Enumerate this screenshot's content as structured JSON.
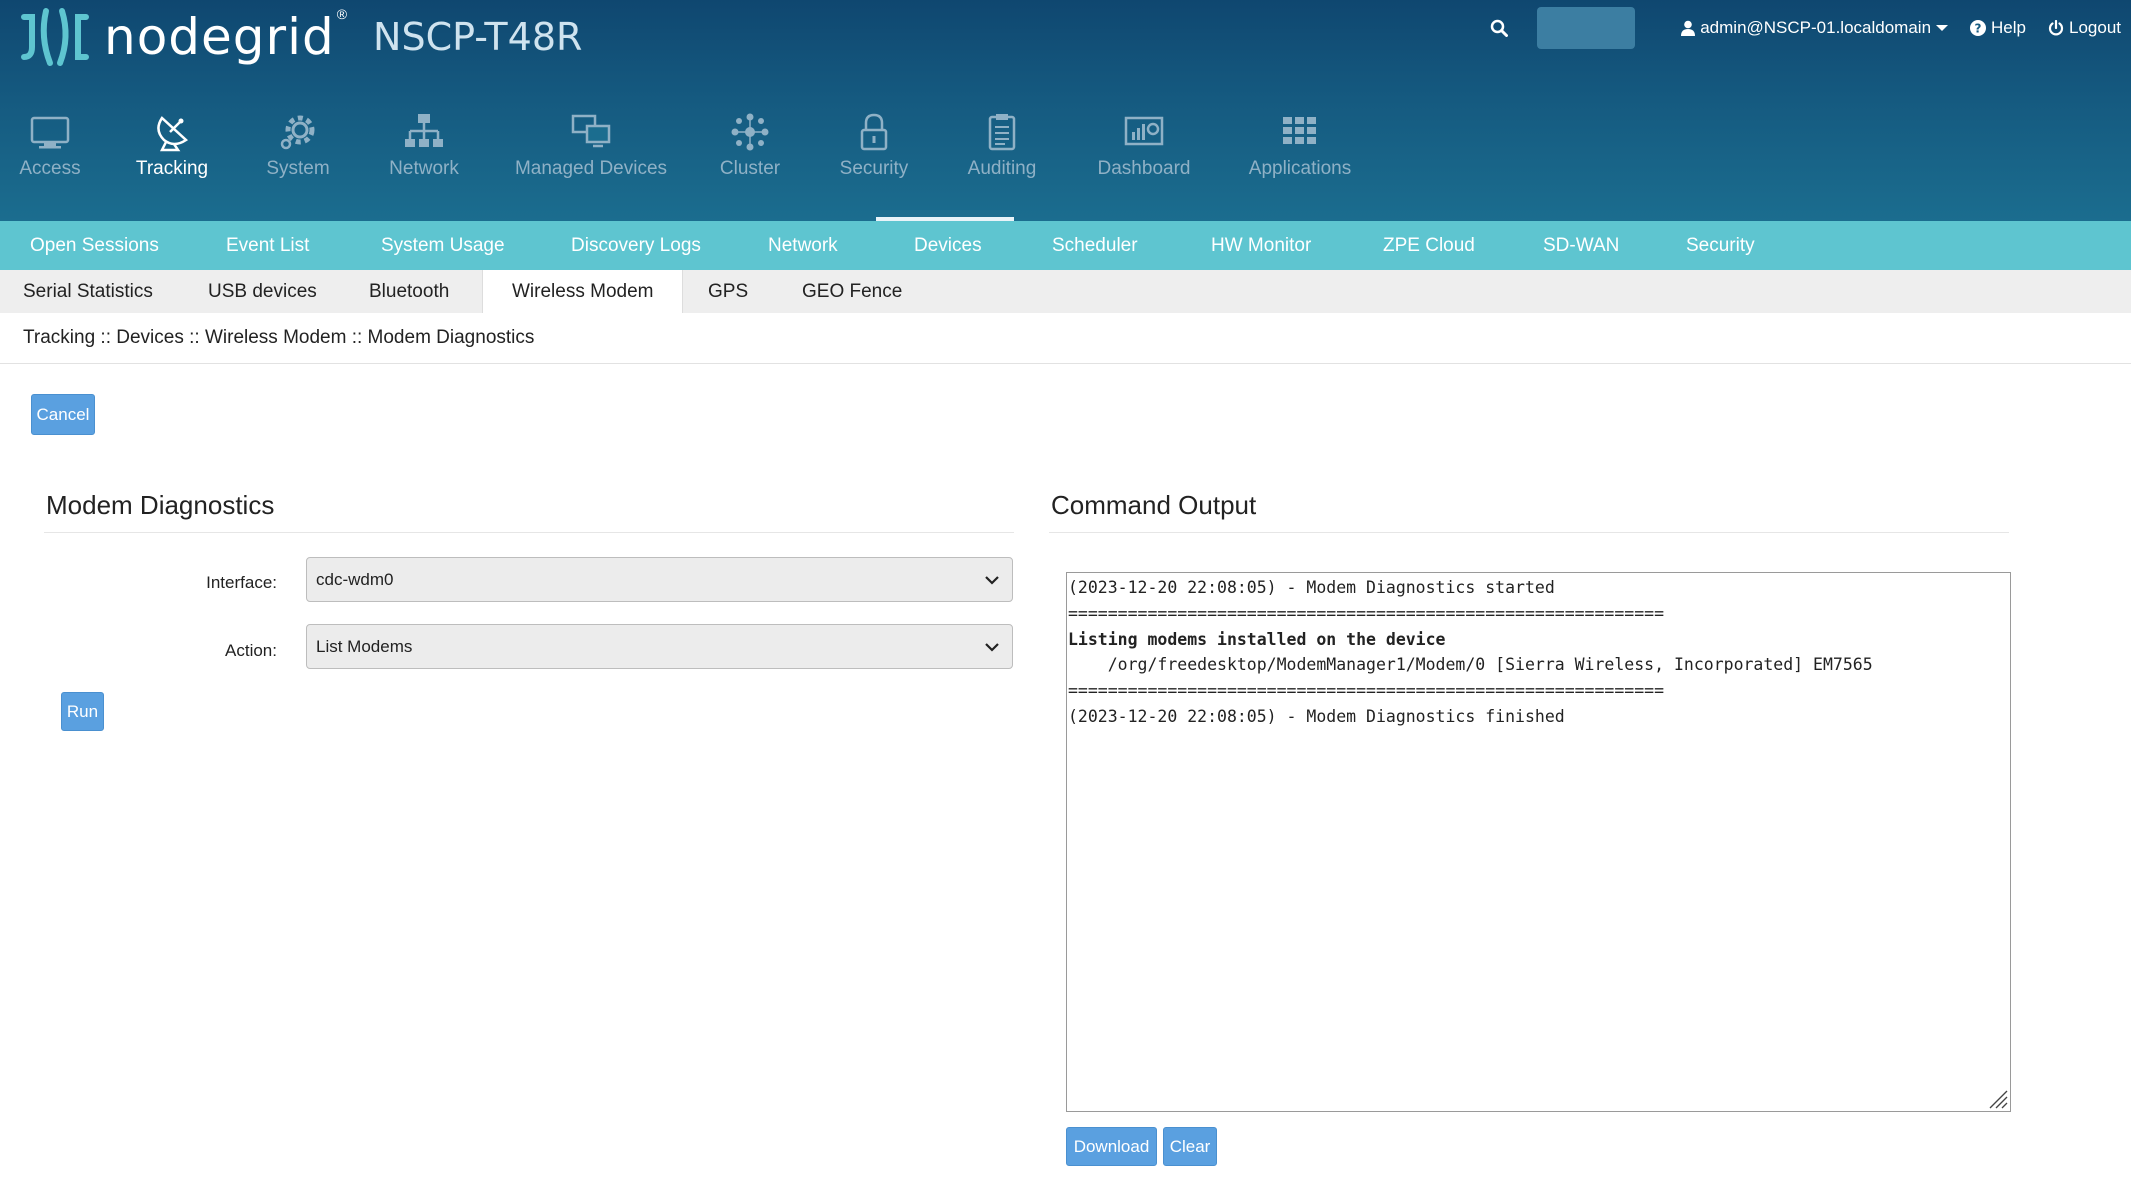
{
  "header": {
    "brand": "nodegrid",
    "registered": "®",
    "model": "NSCP-T48R",
    "user": "admin@NSCP-01.localdomain",
    "help": "Help",
    "logout": "Logout"
  },
  "topnav": [
    {
      "label": "Access",
      "icon": "monitor-icon",
      "active": false
    },
    {
      "label": "Tracking",
      "icon": "satellite-dish-icon",
      "active": true
    },
    {
      "label": "System",
      "icon": "gear-icon",
      "active": false
    },
    {
      "label": "Network",
      "icon": "network-icon",
      "active": false
    },
    {
      "label": "Managed Devices",
      "icon": "managed-devices-icon",
      "active": false
    },
    {
      "label": "Cluster",
      "icon": "cluster-icon",
      "active": false
    },
    {
      "label": "Security",
      "icon": "lock-icon",
      "active": false
    },
    {
      "label": "Auditing",
      "icon": "clipboard-icon",
      "active": false
    },
    {
      "label": "Dashboard",
      "icon": "dashboard-icon",
      "active": false
    },
    {
      "label": "Applications",
      "icon": "grid-icon",
      "active": false
    }
  ],
  "subnav": [
    {
      "label": "Open Sessions"
    },
    {
      "label": "Event List"
    },
    {
      "label": "System Usage"
    },
    {
      "label": "Discovery Logs"
    },
    {
      "label": "Network"
    },
    {
      "label": "Devices",
      "active": true
    },
    {
      "label": "Scheduler"
    },
    {
      "label": "HW Monitor"
    },
    {
      "label": "ZPE Cloud"
    },
    {
      "label": "SD-WAN"
    },
    {
      "label": "Security"
    }
  ],
  "tertnav": [
    {
      "label": "Serial Statistics"
    },
    {
      "label": "USB devices"
    },
    {
      "label": "Bluetooth"
    },
    {
      "label": "Wireless Modem",
      "active": true
    },
    {
      "label": "GPS"
    },
    {
      "label": "GEO Fence"
    }
  ],
  "breadcrumb": "Tracking :: Devices :: Wireless Modem :: Modem Diagnostics",
  "buttons": {
    "cancel": "Cancel",
    "run": "Run",
    "download": "Download",
    "clear": "Clear"
  },
  "diagnostics": {
    "title": "Modem Diagnostics",
    "interface_label": "Interface:",
    "interface_value": "cdc-wdm0",
    "action_label": "Action:",
    "action_value": "List Modems"
  },
  "output": {
    "title": "Command Output",
    "lines": [
      {
        "text": "(2023-12-20 22:08:05) - Modem Diagnostics started",
        "bold": false
      },
      {
        "text": "============================================================",
        "bold": false
      },
      {
        "text": "Listing modems installed on the device",
        "bold": true
      },
      {
        "text": "    /org/freedesktop/ModemManager1/Modem/0 [Sierra Wireless, Incorporated] EM7565",
        "bold": false
      },
      {
        "text": "============================================================",
        "bold": false
      },
      {
        "text": "(2023-12-20 22:08:05) - Modem Diagnostics finished",
        "bold": false
      }
    ]
  },
  "colors": {
    "header_top": "#0f4770",
    "header_bottom": "#1b6d8f",
    "subnav": "#5ec5d0",
    "button": "#5aa0e0"
  }
}
